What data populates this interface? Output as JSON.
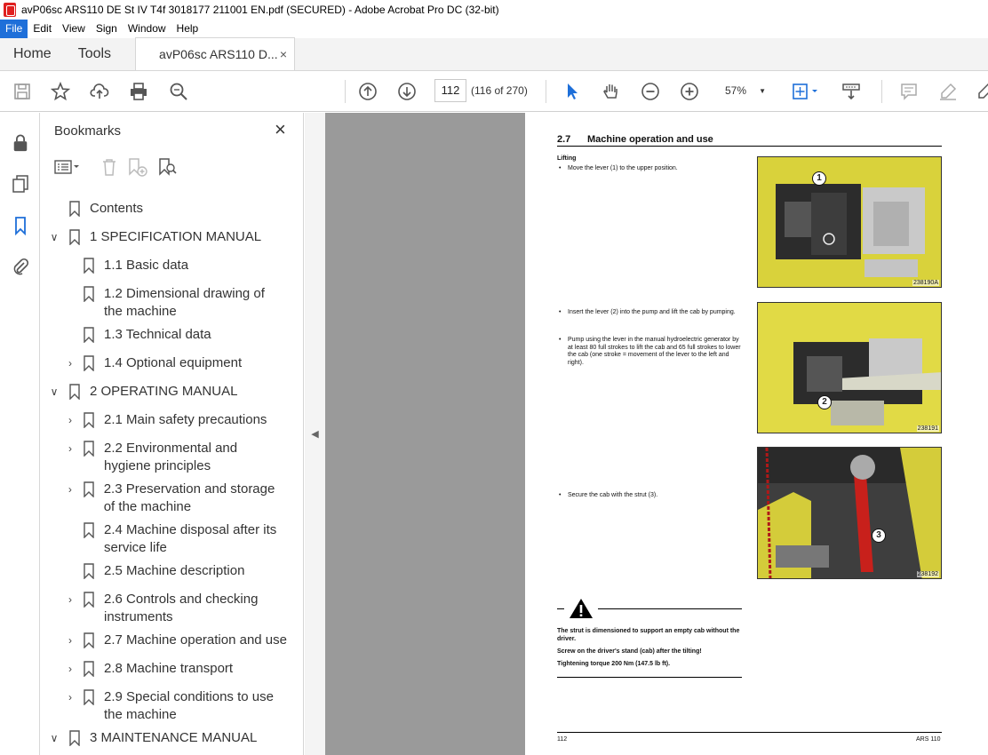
{
  "window": {
    "title": "avP06sc ARS110 DE St IV T4f 3018177 211001 EN.pdf (SECURED) - Adobe Acrobat Pro DC (32-bit)"
  },
  "menu": [
    "File",
    "Edit",
    "View",
    "Sign",
    "Window",
    "Help"
  ],
  "tabs": {
    "home": "Home",
    "tools": "Tools",
    "document": "avP06sc ARS110 D...",
    "close": "×"
  },
  "toolbar": {
    "page_number": "112",
    "page_count": "(116 of 270)",
    "zoom": "57%",
    "zoom_caret": "▼",
    "icons": [
      "save-icon",
      "star-icon",
      "upload-icon",
      "print-icon",
      "find-icon",
      "prev-page-icon",
      "next-page-icon",
      "select-pointer-icon",
      "hand-icon",
      "zoom-out-icon",
      "zoom-in-icon",
      "fit-page-icon",
      "scroll-mode-icon",
      "comment-icon",
      "highlight-icon",
      "sign-icon"
    ]
  },
  "bookmarks": {
    "title": "Bookmarks",
    "close": "×",
    "items": [
      {
        "label": "Contents",
        "level": 0,
        "expander": ""
      },
      {
        "label": "1 SPECIFICATION MANUAL",
        "level": 0,
        "expander": "expanded"
      },
      {
        "label": "1.1 Basic data",
        "level": 1,
        "expander": ""
      },
      {
        "label": "1.2 Dimensional drawing of the machine",
        "level": 1,
        "expander": ""
      },
      {
        "label": "1.3 Technical data",
        "level": 1,
        "expander": ""
      },
      {
        "label": "1.4 Optional equipment",
        "level": 1,
        "expander": "collapsed"
      },
      {
        "label": "2 OPERATING MANUAL",
        "level": 0,
        "expander": "expanded"
      },
      {
        "label": "2.1 Main safety precautions",
        "level": 1,
        "expander": "collapsed"
      },
      {
        "label": "2.2 Environmental and hygiene principles",
        "level": 1,
        "expander": "collapsed"
      },
      {
        "label": "2.3 Preservation and storage of the machine",
        "level": 1,
        "expander": "collapsed"
      },
      {
        "label": "2.4 Machine disposal after its service life",
        "level": 1,
        "expander": ""
      },
      {
        "label": "2.5 Machine description",
        "level": 1,
        "expander": ""
      },
      {
        "label": "2.6 Controls and checking instruments",
        "level": 1,
        "expander": "collapsed"
      },
      {
        "label": "2.7 Machine operation and use",
        "level": 1,
        "expander": "collapsed"
      },
      {
        "label": "2.8 Machine transport",
        "level": 1,
        "expander": "collapsed"
      },
      {
        "label": "2.9 Special conditions to use the machine",
        "level": 1,
        "expander": "collapsed"
      },
      {
        "label": "3 MAINTENANCE MANUAL",
        "level": 0,
        "expander": "expanded"
      }
    ]
  },
  "pdf": {
    "section_number": "2.7",
    "section_title": "Machine operation and use",
    "subheading": "Lifting",
    "step1": "Move the lever (1) to the upper position.",
    "step2": "Insert the lever (2) into the pump and lift the cab by pumping.",
    "step3": "Pump using the lever in the manual hydroelectric generator by at least 80 full strokes to lift the cab and 65 full strokes to lower the cab (one stroke = movement of the lever to the left and right).",
    "step4": "Secure the cab with the strut (3).",
    "photo1_caption": "238190A",
    "photo2_caption": "238191",
    "photo3_caption": "238192",
    "callout1": "1",
    "callout2": "2",
    "callout3": "3",
    "warning_lines": [
      "The strut is dimensioned to support an empty cab without the driver.",
      "Screw on the driver's stand (cab) after the tilting!",
      "Tightening torque 200 Nm (147.5 lb ft)."
    ],
    "footer_page": "112",
    "footer_model": "ARS 110"
  }
}
